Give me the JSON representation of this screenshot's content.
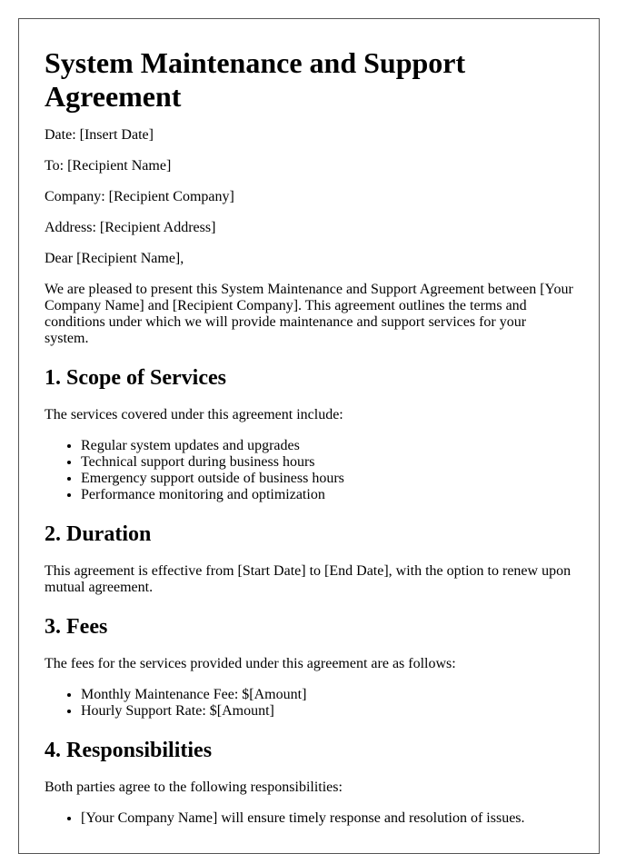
{
  "document": {
    "title": "System Maintenance and Support Agreement",
    "header_fields": [
      "Date: [Insert Date]",
      "To: [Recipient Name]",
      "Company: [Recipient Company]",
      "Address: [Recipient Address]"
    ],
    "salutation": "Dear [Recipient Name],",
    "intro": "We are pleased to present this System Maintenance and Support Agreement between [Your Company Name] and [Recipient Company]. This agreement outlines the terms and conditions under which we will provide maintenance and support services for your system.",
    "sections": [
      {
        "heading": "1. Scope of Services",
        "text": "The services covered under this agreement include:",
        "items": [
          "Regular system updates and upgrades",
          "Technical support during business hours",
          "Emergency support outside of business hours",
          "Performance monitoring and optimization"
        ]
      },
      {
        "heading": "2. Duration",
        "text": "This agreement is effective from [Start Date] to [End Date], with the option to renew upon mutual agreement."
      },
      {
        "heading": "3. Fees",
        "text": "The fees for the services provided under this agreement are as follows:",
        "items": [
          "Monthly Maintenance Fee: $[Amount]",
          "Hourly Support Rate: $[Amount]"
        ]
      },
      {
        "heading": "4. Responsibilities",
        "text": "Both parties agree to the following responsibilities:",
        "items": [
          "[Your Company Name] will ensure timely response and resolution of issues."
        ]
      }
    ]
  }
}
